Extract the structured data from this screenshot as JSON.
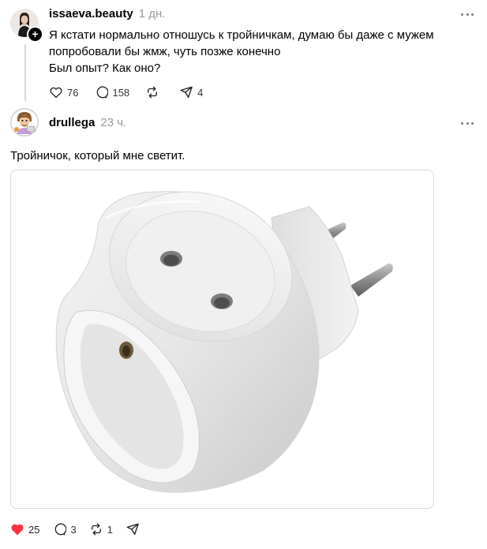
{
  "posts": [
    {
      "username": "issaeva.beauty",
      "time": "1 дн.",
      "text_lines": [
        "Я кстати нормально отношусь к тройничкам, думаю бы даже с мужем",
        "попробовали бы жмж, чуть позже конечно",
        "Был опыт? Как оно?"
      ],
      "likes": "76",
      "replies": "158",
      "reposts": "",
      "shares": "4",
      "follow_symbol": "+"
    },
    {
      "username": "drullega",
      "time": "23 ч.",
      "text": "Тройничок, который мне светит.",
      "likes": "25",
      "replies": "3",
      "reposts": "1",
      "shares": "",
      "liked": true
    }
  ],
  "colors": {
    "like_active": "#ff3040",
    "muted_text": "#999999",
    "divider": "#d9d9d9"
  },
  "icons": [
    "heart-icon",
    "comment-icon",
    "repost-icon",
    "share-icon",
    "more-icon"
  ]
}
